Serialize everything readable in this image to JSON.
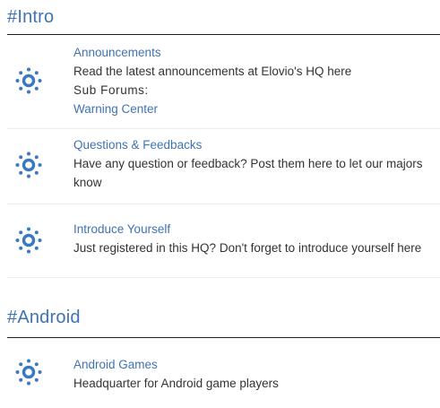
{
  "sections": [
    {
      "title": "#Intro",
      "forums": [
        {
          "icon": "forum-sun-icon",
          "title": "Announcements",
          "description": "Read the latest announcements at Elovio's HQ here",
          "subforums_label": "Sub Forums:",
          "subforums": [
            "Warning Center"
          ]
        },
        {
          "icon": "forum-sun-icon",
          "title": "Questions & Feedbacks",
          "description": "Have any question or feedback? Post them here to let our majors know"
        },
        {
          "icon": "forum-sun-icon",
          "title": "Introduce Yourself",
          "description": "Just registered in this HQ? Don't forget to introduce yourself here"
        }
      ]
    },
    {
      "title": "#Android",
      "forums": [
        {
          "icon": "forum-sun-icon",
          "title": "Android Games",
          "description": "Headquarter for Android game players"
        }
      ]
    }
  ],
  "colors": {
    "accent": "#3f73b4",
    "text": "#333333",
    "icon": "#3a78c2"
  }
}
